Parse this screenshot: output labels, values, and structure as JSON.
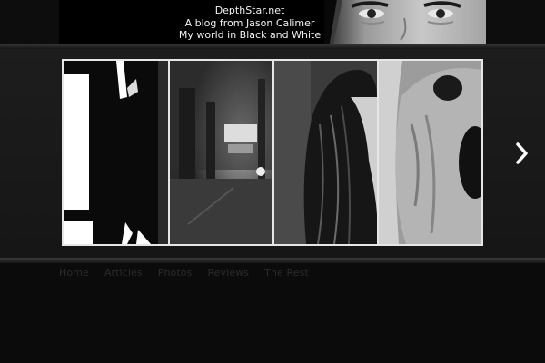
{
  "site": {
    "name": "DepthStar.net",
    "tagline": "A blog from Jason Calimer",
    "subtagline": "My world in Black and White"
  },
  "slider": {
    "slides": [
      {
        "label": "abstract-shadow"
      },
      {
        "label": "street-night"
      },
      {
        "label": "woman-hair"
      },
      {
        "label": "dog-closeup"
      }
    ]
  },
  "nav": {
    "items": [
      "Home",
      "Articles",
      "Photos",
      "Reviews",
      "The Rest"
    ]
  }
}
